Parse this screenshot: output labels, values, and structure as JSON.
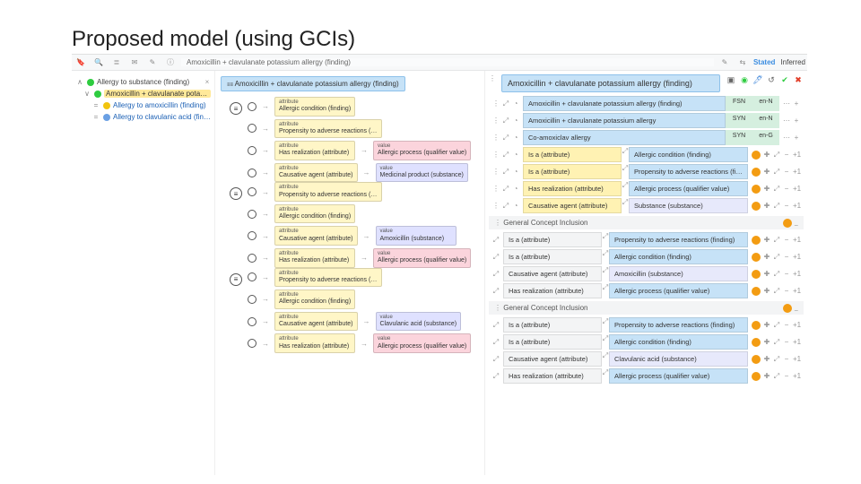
{
  "slide": {
    "title": "Proposed model (using GCIs)"
  },
  "toolbar": {
    "icons": [
      "bookmark",
      "search",
      "tree",
      "mail",
      "compose",
      "info"
    ],
    "breadcrumb": "Amoxicillin + clavulanate potassium allergy (finding)",
    "right": {
      "stated": "Stated",
      "inferred": "Inferred"
    }
  },
  "tree": {
    "parent": {
      "label": "Allergy to substance (finding)"
    },
    "selected": {
      "label": "Amoxicillin + clavulanate potassium allergy (finding)"
    },
    "children": [
      {
        "color": "yellow",
        "label": "Allergy to amoxicillin (finding)"
      },
      {
        "color": "blue",
        "label": "Allergy to clavulanic acid (finding)"
      }
    ]
  },
  "diagram": {
    "root": {
      "kind": "equiv",
      "label": "Amoxicillin + clavulanate potassium allergy (finding)"
    },
    "groups": [
      {
        "rows": [
          {
            "attr_kind": "attr",
            "attr": "Allergic condition (finding)",
            "val_kind": "",
            "val": ""
          },
          {
            "attr_kind": "attr",
            "attr": "Propensity to adverse reactions (finding)",
            "val_kind": "",
            "val": ""
          },
          {
            "attr_kind": "attr",
            "attr": "Has realization (attribute)",
            "val_kind": "qual",
            "val": "Allergic process (qualifier value)"
          },
          {
            "attr_kind": "attr",
            "attr": "Causative agent (attribute)",
            "val_kind": "sub",
            "val": "Medicinal product (substance)"
          }
        ]
      },
      {
        "rows": [
          {
            "attr_kind": "attr",
            "attr": "Propensity to adverse reactions (finding)",
            "val_kind": "",
            "val": ""
          },
          {
            "attr_kind": "attr",
            "attr": "Allergic condition (finding)",
            "val_kind": "",
            "val": ""
          },
          {
            "attr_kind": "attr",
            "attr": "Causative agent (attribute)",
            "val_kind": "sub",
            "val": "Amoxicillin (substance)"
          },
          {
            "attr_kind": "attr",
            "attr": "Has realization (attribute)",
            "val_kind": "qual",
            "val": "Allergic process (qualifier value)"
          }
        ]
      },
      {
        "rows": [
          {
            "attr_kind": "attr",
            "attr": "Propensity to adverse reactions (finding)",
            "val_kind": "",
            "val": ""
          },
          {
            "attr_kind": "attr",
            "attr": "Allergic condition (finding)",
            "val_kind": "",
            "val": ""
          },
          {
            "attr_kind": "attr",
            "attr": "Causative agent (attribute)",
            "val_kind": "sub",
            "val": "Clavulanic acid (substance)"
          },
          {
            "attr_kind": "attr",
            "attr": "Has realization (attribute)",
            "val_kind": "qual",
            "val": "Allergic process (qualifier value)"
          }
        ]
      }
    ]
  },
  "details": {
    "title": "Amoxicillin + clavulanate potassium allergy (finding)",
    "top_rows": [
      {
        "dots": "22",
        "attr": "",
        "val": "Amoxicillin + clavulanate potassium allergy (finding)",
        "band": "blue",
        "tag1": "FSN",
        "tag2": "en-N"
      },
      {
        "dots": "22",
        "attr": "",
        "val": "Amoxicillin + clavulanate potassium allergy",
        "band": "blue",
        "tag1": "SYN",
        "tag2": "en-N"
      },
      {
        "dots": "12",
        "attr": "",
        "val": "Co-amoxiclav allergy",
        "band": "blue",
        "tag1": "SYN",
        "tag2": "en-G"
      }
    ],
    "mid_rows": [
      {
        "attr": "Is a (attribute)",
        "val": "Allergic condition (finding)",
        "attr_band": "yellow",
        "val_band": "blue",
        "pill": true
      },
      {
        "attr": "Is a (attribute)",
        "val": "Propensity to adverse reactions (finding)",
        "attr_band": "yellow",
        "val_band": "blue",
        "pill": true
      },
      {
        "attr": "Has realization (attribute)",
        "val": "Allergic process (qualifier value)",
        "attr_band": "yellow",
        "val_band": "blue",
        "pill": true
      },
      {
        "attr": "Causative agent (attribute)",
        "val": "Substance (substance)",
        "attr_band": "yellow",
        "val_band": "purple",
        "pill": true
      }
    ],
    "sections": [
      {
        "title": "General Concept Inclusion",
        "rows": [
          {
            "attr": "Is a (attribute)",
            "val": "Propensity to adverse reactions (finding)",
            "attr_band": "grey",
            "val_band": "blue"
          },
          {
            "attr": "Is a (attribute)",
            "val": "Allergic condition (finding)",
            "attr_band": "grey",
            "val_band": "blue"
          },
          {
            "attr": "Causative agent (attribute)",
            "val": "Amoxicillin (substance)",
            "attr_band": "grey",
            "val_band": "purple"
          },
          {
            "attr": "Has realization (attribute)",
            "val": "Allergic process (qualifier value)",
            "attr_band": "grey",
            "val_band": "blue"
          }
        ]
      },
      {
        "title": "General Concept Inclusion",
        "rows": [
          {
            "attr": "Is a (attribute)",
            "val": "Propensity to adverse reactions (finding)",
            "attr_band": "grey",
            "val_band": "blue"
          },
          {
            "attr": "Is a (attribute)",
            "val": "Allergic condition (finding)",
            "attr_band": "grey",
            "val_band": "blue"
          },
          {
            "attr": "Causative agent (attribute)",
            "val": "Clavulanic acid (substance)",
            "attr_band": "grey",
            "val_band": "purple"
          },
          {
            "attr": "Has realization (attribute)",
            "val": "Allergic process (qualifier value)",
            "attr_band": "grey",
            "val_band": "blue"
          }
        ]
      }
    ]
  }
}
